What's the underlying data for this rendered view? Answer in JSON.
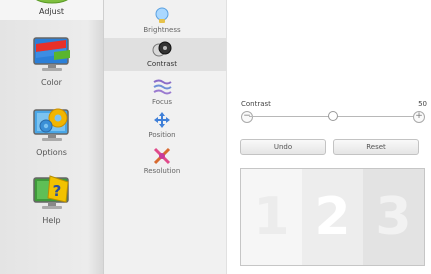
{
  "sidebar": {
    "items": [
      {
        "label": "Adjust",
        "icon": "adjust-icon",
        "selected": true
      },
      {
        "label": "Color",
        "icon": "color-icon"
      },
      {
        "label": "Options",
        "icon": "options-icon"
      },
      {
        "label": "Help",
        "icon": "help-icon"
      }
    ]
  },
  "subnav": {
    "items": [
      {
        "label": "Brightness",
        "icon": "brightness-icon"
      },
      {
        "label": "Contrast",
        "icon": "contrast-icon",
        "selected": true
      },
      {
        "label": "Focus",
        "icon": "focus-icon"
      },
      {
        "label": "Position",
        "icon": "position-icon"
      },
      {
        "label": "Resolution",
        "icon": "resolution-icon"
      }
    ]
  },
  "control": {
    "label": "Contrast",
    "value": "50",
    "min": 0,
    "max": 100,
    "minus_symbol": "−",
    "plus_symbol": "+"
  },
  "buttons": {
    "undo": "Undo",
    "reset": "Reset"
  },
  "preview": {
    "digits": [
      "1",
      "2",
      "3"
    ]
  },
  "colors": {
    "sidebar_bg": "#e6e6e6",
    "panel_bg": "#f1f1f1",
    "selected_bg": "#e0e0e0"
  }
}
